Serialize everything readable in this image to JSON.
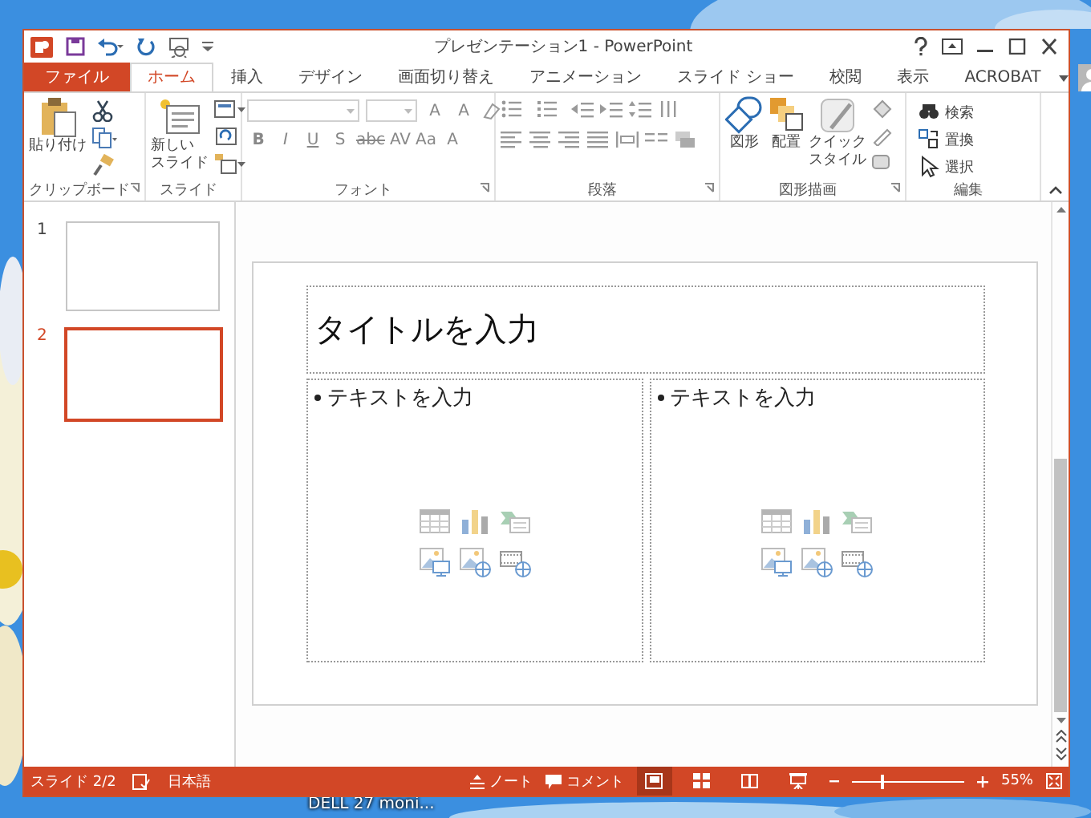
{
  "desktop": {
    "label": "DELL 27 moni..."
  },
  "window": {
    "title": "プレゼンテーション1 - PowerPoint"
  },
  "tabs": [
    {
      "label": "ファイル",
      "kind": "file",
      "selected": false
    },
    {
      "label": "ホーム",
      "kind": "tab",
      "selected": true
    },
    {
      "label": "挿入",
      "kind": "tab",
      "selected": false
    },
    {
      "label": "デザイン",
      "kind": "tab",
      "selected": false
    },
    {
      "label": "画面切り替え",
      "kind": "tab",
      "selected": false
    },
    {
      "label": "アニメーション",
      "kind": "tab",
      "selected": false
    },
    {
      "label": "スライド ショー",
      "kind": "tab",
      "selected": false
    },
    {
      "label": "校閲",
      "kind": "tab",
      "selected": false
    },
    {
      "label": "表示",
      "kind": "tab",
      "selected": false
    },
    {
      "label": "ACROBAT",
      "kind": "tab",
      "selected": false
    }
  ],
  "ribbon": {
    "clipboard": {
      "label": "クリップボード",
      "paste": "貼り付け"
    },
    "slides": {
      "label": "スライド",
      "new_slide": [
        "新しい",
        "スライド"
      ]
    },
    "font": {
      "label": "フォント",
      "grow": "A",
      "shrink": "A",
      "buttons": [
        "B",
        "I",
        "U",
        "S",
        "abc",
        "AV",
        "Aa",
        "A"
      ]
    },
    "paragraph": {
      "label": "段落"
    },
    "drawing": {
      "label": "図形描画",
      "shapes": "図形",
      "arrange": "配置",
      "quick_styles": [
        "クイック",
        "スタイル"
      ]
    },
    "editing": {
      "label": "編集",
      "items": [
        {
          "kind": "find",
          "label": "検索"
        },
        {
          "kind": "replace",
          "label": "置換"
        },
        {
          "kind": "select",
          "label": "選択"
        }
      ]
    }
  },
  "slides": [
    {
      "number": "1",
      "selected": false
    },
    {
      "number": "2",
      "selected": true
    }
  ],
  "slide": {
    "title_placeholder": "タイトルを入力",
    "content_placeholders": [
      {
        "text": "テキストを入力"
      },
      {
        "text": "テキストを入力"
      }
    ]
  },
  "status_bar": {
    "slide_info": "スライド 2/2",
    "language": "日本語",
    "notes": "ノート",
    "comments": "コメント",
    "views": [
      {
        "kind": "normal",
        "selected": true
      },
      {
        "kind": "sorter",
        "selected": false
      },
      {
        "kind": "reading",
        "selected": false
      },
      {
        "kind": "show",
        "selected": false
      }
    ],
    "zoom": {
      "level": 0.27,
      "reading": "55%"
    }
  }
}
